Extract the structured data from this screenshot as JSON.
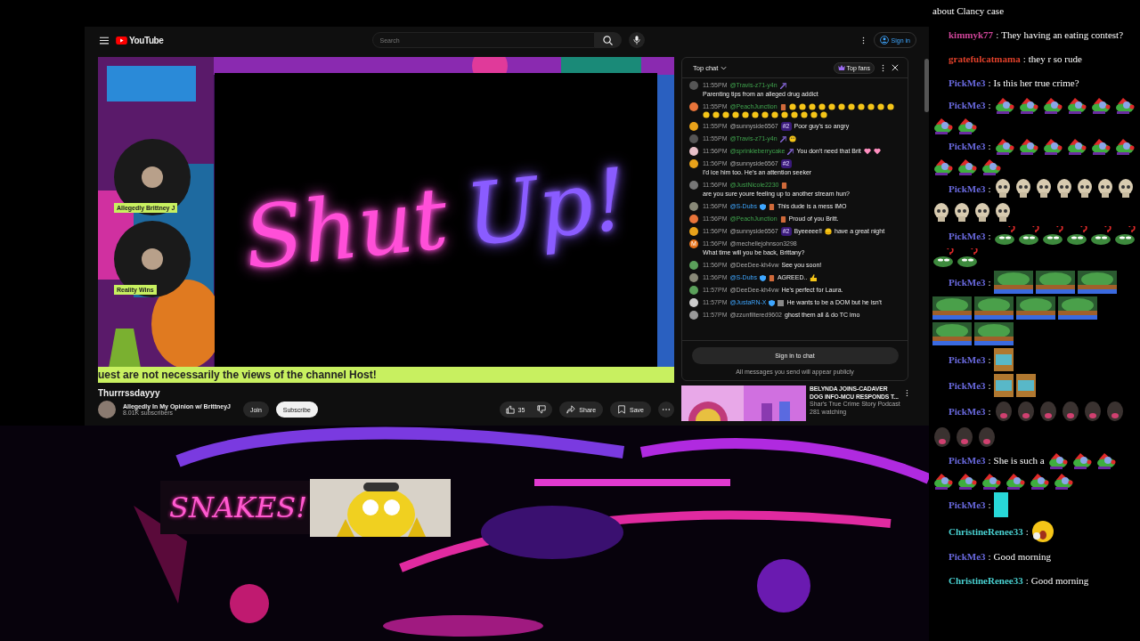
{
  "youtube": {
    "logo": "YouTube",
    "search": {
      "placeholder": "Search"
    },
    "sign_in": "Sign in",
    "video": {
      "neon_words": [
        {
          "text": "Shut",
          "color": "#ff4fd8"
        },
        {
          "text": "Up!",
          "color": "#8a5cff"
        }
      ],
      "guests": [
        {
          "name": "Allegedly Brittney J"
        },
        {
          "name": "Reality Wins"
        }
      ],
      "ticker": "uest are not necessarily the views of the channel Host!"
    },
    "title": "Thurrrssdayyy",
    "channel": {
      "name": "Allegedly In My Opinion w/ BrittneyJ",
      "subscribers": "8.01K subscribers"
    },
    "join": "Join",
    "subscribe": "Subscribe",
    "likes": "35",
    "share": "Share",
    "save": "Save",
    "chat": {
      "mode": "Top chat",
      "top_fans": "Top fans",
      "messages": [
        {
          "time": "11:55PM",
          "author": "@Travis-z71-y4n",
          "kind": "member",
          "color": "#555555",
          "badges": [
            {
              "kind": "wand"
            }
          ],
          "text": "Parenting tips from an alleged drug addict"
        },
        {
          "time": "11:55PM",
          "author": "@PeachJunction",
          "kind": "member",
          "color": "#e8743a",
          "badges": [
            {
              "kind": "member"
            }
          ],
          "emotes": [
            {
              "kind": "clap"
            },
            {
              "kind": "clap"
            },
            {
              "kind": "clap"
            },
            {
              "kind": "clap"
            },
            {
              "kind": "clap"
            },
            {
              "kind": "clap"
            },
            {
              "kind": "clap"
            },
            {
              "kind": "clap"
            },
            {
              "kind": "clap"
            },
            {
              "kind": "clap"
            },
            {
              "kind": "clap"
            },
            {
              "kind": "clap"
            },
            {
              "kind": "clap"
            },
            {
              "kind": "clap"
            },
            {
              "kind": "clap"
            },
            {
              "kind": "clap"
            },
            {
              "kind": "clap"
            },
            {
              "kind": "clap"
            },
            {
              "kind": "clap"
            },
            {
              "kind": "clap"
            },
            {
              "kind": "clap"
            },
            {
              "kind": "clap"
            },
            {
              "kind": "clap"
            },
            {
              "kind": "clap"
            }
          ]
        },
        {
          "time": "11:55PM",
          "author": "@sunnyside6567",
          "kind": "viewer",
          "color": "#e8a21a",
          "rank": "#2",
          "text": "Poor guy's so angry"
        },
        {
          "time": "11:55PM",
          "author": "@Travis-z71-y4n",
          "kind": "member",
          "color": "#555555",
          "badges": [
            {
              "kind": "wand"
            }
          ],
          "emotes": [
            {
              "kind": "smile"
            }
          ]
        },
        {
          "time": "11:56PM",
          "author": "@sprinkleberrycake",
          "kind": "member",
          "color": "#e8c0c8",
          "badges": [
            {
              "kind": "wand"
            }
          ],
          "text": "You don't need that Brit",
          "emotes": [
            {
              "kind": "heart"
            },
            {
              "kind": "heart"
            }
          ]
        },
        {
          "time": "11:56PM",
          "author": "@sunnyside6567",
          "kind": "viewer",
          "color": "#e8a21a",
          "rank": "#2",
          "text": "I'd ice him too. He's an attention seeker"
        },
        {
          "time": "11:56PM",
          "author": "@JustNicole2230",
          "kind": "member",
          "color": "#777777",
          "badges": [
            {
              "kind": "member"
            }
          ],
          "text": "are you sure youre feeling up to another stream hun?"
        },
        {
          "time": "11:56PM",
          "author": "@S-Dubs",
          "kind": "verified",
          "color": "#888877",
          "badges": [
            {
              "kind": "verified"
            },
            {
              "kind": "member"
            }
          ],
          "text": "This dude is a mess IMO"
        },
        {
          "time": "11:56PM",
          "author": "@PeachJunction",
          "kind": "member",
          "color": "#e8743a",
          "badges": [
            {
              "kind": "member"
            }
          ],
          "text": "Proud of you Britt."
        },
        {
          "time": "11:56PM",
          "author": "@sunnyside6567",
          "kind": "viewer",
          "color": "#e8a21a",
          "rank": "#2",
          "text": "Byeeeee!!",
          "emotes": [
            {
              "kind": "hug"
            }
          ],
          "text_after": "have a great night"
        },
        {
          "time": "11:56PM",
          "author": "@mechellejohnson3298",
          "kind": "viewer",
          "color": "#e8731a",
          "initial": "M",
          "text": "What time will you be back, Brittany?"
        },
        {
          "time": "11:56PM",
          "author": "@DeeDee-kh4vw",
          "kind": "viewer",
          "color": "#5aa05a",
          "text": "See you soon!"
        },
        {
          "time": "11:56PM",
          "author": "@S-Dubs",
          "kind": "verified",
          "color": "#888877",
          "badges": [
            {
              "kind": "verified"
            },
            {
              "kind": "member"
            }
          ],
          "text": "AGREED..",
          "emotes": [
            {
              "kind": "thumbs"
            }
          ]
        },
        {
          "time": "11:57PM",
          "author": "@DeeDee-kh4vw",
          "kind": "viewer",
          "color": "#5aa05a",
          "text": "He's perfect for Laura."
        },
        {
          "time": "11:57PM",
          "author": "@JustaRN-X",
          "kind": "verified",
          "color": "#cccccc",
          "badges": [
            {
              "kind": "verified"
            },
            {
              "kind": "bar"
            }
          ],
          "text": "He wants to be a DOM but he isn't"
        },
        {
          "time": "11:57PM",
          "author": "@zzunfiltered9602",
          "kind": "viewer",
          "color": "#999999",
          "text": "ghost them all & do TC imo"
        }
      ],
      "sign_in_button": "Sign in to chat",
      "notice": "All messages you send will appear publicly"
    },
    "recommended": {
      "kind": "picture",
      "title": "BELYNDA JOINS-CADAVER DOG INFO-MCU RESPONDS T...",
      "channel": "Shar's True Crime Story Podcast",
      "watching": "281 watching"
    }
  },
  "sign": {
    "text": "SNAKES!"
  },
  "overlay_chat": [
    {
      "text": "about Clancy case"
    },
    {
      "name": "kimmyk77",
      "color": "#d0459a",
      "sep": ":",
      "text": "They having an eating contest?"
    },
    {
      "name": "gratefulcatmama",
      "color": "#e0402a",
      "sep": ":",
      "text": "they r so rude"
    },
    {
      "name": "PickMe3",
      "color": "#6a6ae0",
      "sep": ":",
      "text": "Is this her true crime?"
    },
    {
      "name": "PickMe3",
      "color": "#6a6ae0",
      "sep": ":",
      "emotes": [
        {
          "kind": "frog-clown"
        },
        {
          "kind": "frog-clown"
        },
        {
          "kind": "frog-clown"
        },
        {
          "kind": "frog-clown"
        },
        {
          "kind": "frog-clown"
        },
        {
          "kind": "frog-clown"
        },
        {
          "kind": "frog-clown"
        },
        {
          "kind": "frog-clown"
        }
      ]
    },
    {
      "name": "PickMe3",
      "color": "#6a6ae0",
      "sep": ":",
      "emotes": [
        {
          "kind": "frog-clown"
        },
        {
          "kind": "frog-clown"
        },
        {
          "kind": "frog-clown"
        },
        {
          "kind": "frog-clown"
        },
        {
          "kind": "frog-clown"
        },
        {
          "kind": "frog-clown"
        },
        {
          "kind": "frog-clown"
        },
        {
          "kind": "frog-clown"
        },
        {
          "kind": "frog-clown"
        }
      ]
    },
    {
      "name": "PickMe3",
      "color": "#6a6ae0",
      "sep": ":",
      "emotes": [
        {
          "kind": "skull"
        },
        {
          "kind": "skull"
        },
        {
          "kind": "skull"
        },
        {
          "kind": "skull"
        },
        {
          "kind": "skull"
        },
        {
          "kind": "skull"
        },
        {
          "kind": "skull"
        },
        {
          "kind": "skull"
        },
        {
          "kind": "skull"
        },
        {
          "kind": "skull"
        },
        {
          "kind": "skull"
        }
      ]
    },
    {
      "name": "PickMe3",
      "color": "#6a6ae0",
      "sep": ":",
      "emotes": [
        {
          "kind": "frog-question"
        },
        {
          "kind": "frog-question"
        },
        {
          "kind": "frog-question"
        },
        {
          "kind": "frog-question"
        },
        {
          "kind": "frog-question"
        },
        {
          "kind": "frog-question"
        },
        {
          "kind": "frog-question"
        },
        {
          "kind": "frog-question"
        }
      ]
    },
    {
      "name": "PickMe3",
      "color": "#6a6ae0",
      "sep": ":",
      "emotes": [
        {
          "kind": "frog-bed"
        },
        {
          "kind": "frog-bed"
        },
        {
          "kind": "frog-bed"
        },
        {
          "kind": "frog-bed"
        },
        {
          "kind": "frog-bed"
        },
        {
          "kind": "frog-bed"
        },
        {
          "kind": "frog-bed"
        },
        {
          "kind": "frog-bed"
        },
        {
          "kind": "frog-bed"
        }
      ]
    },
    {
      "name": "PickMe3",
      "color": "#6a6ae0",
      "sep": ":",
      "emotes": [
        {
          "kind": "tile"
        }
      ]
    },
    {
      "name": "PickMe3",
      "color": "#6a6ae0",
      "sep": ":",
      "emotes": [
        {
          "kind": "tile"
        },
        {
          "kind": "tile"
        }
      ]
    },
    {
      "name": "PickMe3",
      "color": "#6a6ae0",
      "sep": ":",
      "emotes": [
        {
          "kind": "dog"
        },
        {
          "kind": "dog"
        },
        {
          "kind": "dog"
        },
        {
          "kind": "dog"
        },
        {
          "kind": "dog"
        },
        {
          "kind": "dog"
        },
        {
          "kind": "dog"
        },
        {
          "kind": "dog"
        },
        {
          "kind": "dog"
        }
      ]
    },
    {
      "name": "PickMe3",
      "color": "#6a6ae0",
      "sep": ":",
      "text": "She is such a",
      "emotes": [
        {
          "kind": "frog-clown"
        },
        {
          "kind": "frog-clown"
        },
        {
          "kind": "frog-clown"
        },
        {
          "kind": "frog-clown"
        },
        {
          "kind": "frog-clown"
        },
        {
          "kind": "frog-clown"
        },
        {
          "kind": "frog-clown"
        },
        {
          "kind": "frog-clown"
        },
        {
          "kind": "frog-clown"
        }
      ]
    },
    {
      "name": "PickMe3",
      "color": "#6a6ae0",
      "sep": ":",
      "emotes": [
        {
          "kind": "word-art"
        }
      ]
    },
    {
      "name": "ChristineRenee33",
      "color": "#49d0d0",
      "sep": ":",
      "emotes": [
        {
          "kind": "yawn"
        }
      ]
    },
    {
      "name": "PickMe3",
      "color": "#6a6ae0",
      "sep": ":",
      "text": "Good morning"
    },
    {
      "name": "ChristineRenee33",
      "color": "#49d0d0",
      "sep": ":",
      "text": "Good morning"
    }
  ]
}
